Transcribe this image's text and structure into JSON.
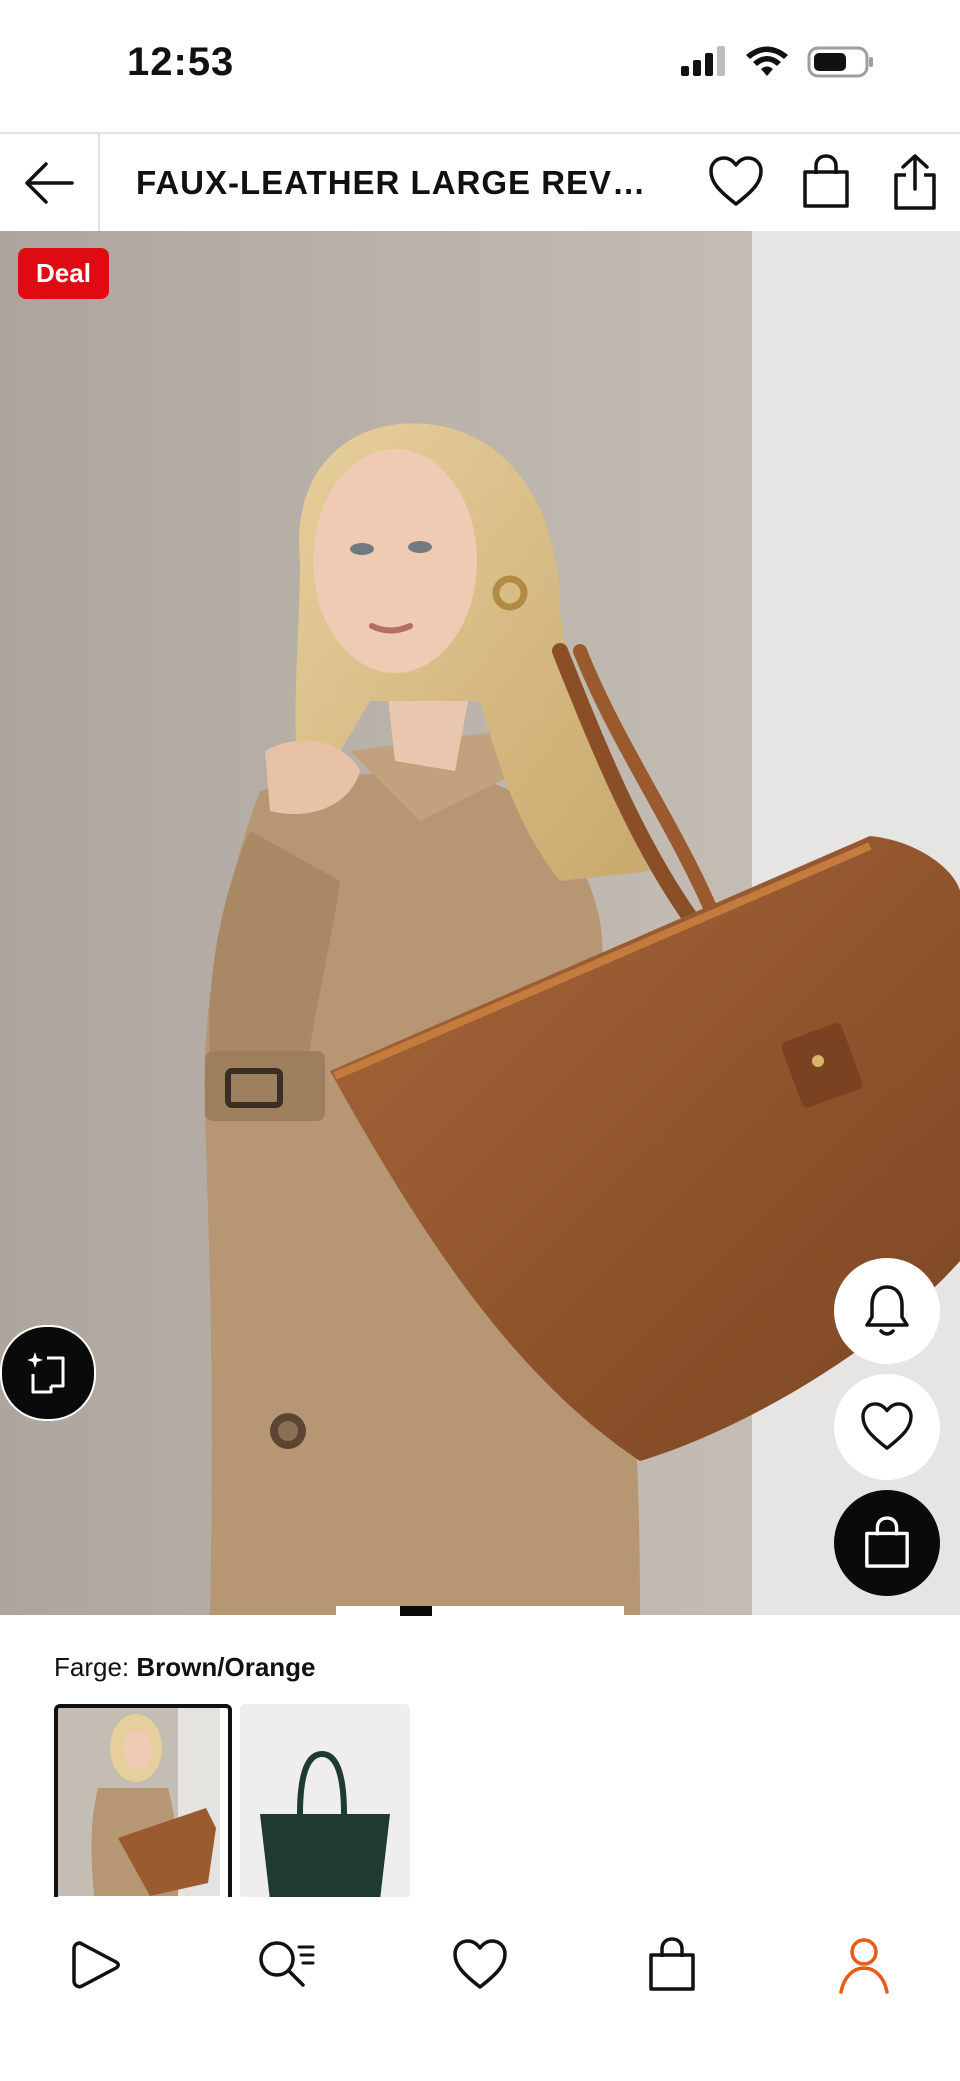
{
  "status_bar": {
    "time": "12:53"
  },
  "header": {
    "title": "FAUX-LEATHER LARGE REV…",
    "icons": [
      "back-arrow-icon",
      "heart-icon",
      "bag-icon",
      "share-icon"
    ]
  },
  "hero": {
    "badge": "Deal",
    "gallery_index": 1
  },
  "colors": {
    "label": "Farge:",
    "selected": "Brown/Orange",
    "options": [
      {
        "name": "Brown/Orange",
        "swatch": "#8b5a2b",
        "selected": true
      },
      {
        "name": "Green",
        "swatch": "#1f3a2e",
        "selected": false
      }
    ]
  },
  "bottom_nav": {
    "items": [
      "home-icon",
      "search-icon",
      "wishlist-icon",
      "bag-icon",
      "profile-icon"
    ],
    "active_color": "#e85a1a"
  },
  "theme": {
    "deal_red": "#e00b12",
    "bag_brown": "#9a5b2e",
    "coat_tan": "#b99a73",
    "backdrop": "#b9b2aa"
  }
}
